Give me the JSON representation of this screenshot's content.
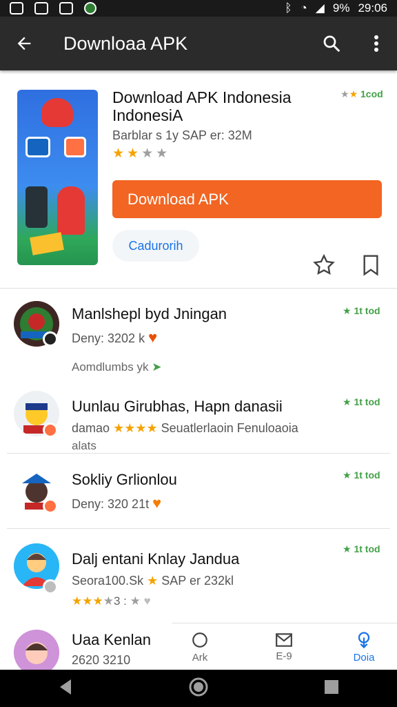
{
  "status_bar": {
    "battery": "9%",
    "time": "29:06"
  },
  "app_bar": {
    "title": "Downloaa APK",
    "back_icon": "arrow-left-icon",
    "search_icon": "search-icon",
    "more_icon": "more-vert-icon"
  },
  "hero": {
    "title": "Download APK Indonesia IndonesiA",
    "badge": "1cod",
    "meta": "Barblar s 1y SAP er: 32M",
    "rating": 2,
    "download_label": "Download APK",
    "chip_label": "Cadurorih",
    "colors": {
      "download": "#f26522",
      "chip_text": "#1a73e8"
    }
  },
  "list": [
    {
      "title": "Manlshepl byd Jningan",
      "subtitle": "Deny: 3202 k",
      "extra": "Aomdlumbs yk",
      "badge": "1t tod",
      "avatar_icon": "avatar-icon"
    },
    {
      "title": "Uunlau Girubhas, Hapn danasii",
      "subtitle": "damao",
      "subtitle_tail": "Seuatlerlaoin Fenuloaoia",
      "extra": "alats",
      "rating": 4,
      "badge": "1t tod",
      "avatar_icon": "avatar-icon"
    },
    {
      "title": "Sokliy Grlionlou",
      "subtitle": "Deny: 320 21t",
      "badge": "1t tod",
      "avatar_icon": "avatar-icon"
    },
    {
      "title": "Dalj entani Knlay Jandua",
      "subtitle": "Seora100.Sk",
      "subtitle_tail": "SAP er 232kl",
      "extra": "3",
      "rating": 3,
      "badge": "1t tod",
      "avatar_icon": "avatar-icon"
    },
    {
      "title": "Uaa Kenlan",
      "subtitle": "2620 3210",
      "avatar_icon": "avatar-icon"
    }
  ],
  "bottom_nav": [
    {
      "label": "Ark",
      "icon": "circle-icon"
    },
    {
      "label": "E-9",
      "icon": "mail-icon"
    },
    {
      "label": "Doia",
      "icon": "download-icon",
      "active": true
    }
  ],
  "system_nav": {
    "back_icon": "back-triangle-icon",
    "home_icon": "home-circle-icon",
    "recents_icon": "recents-square-icon"
  }
}
